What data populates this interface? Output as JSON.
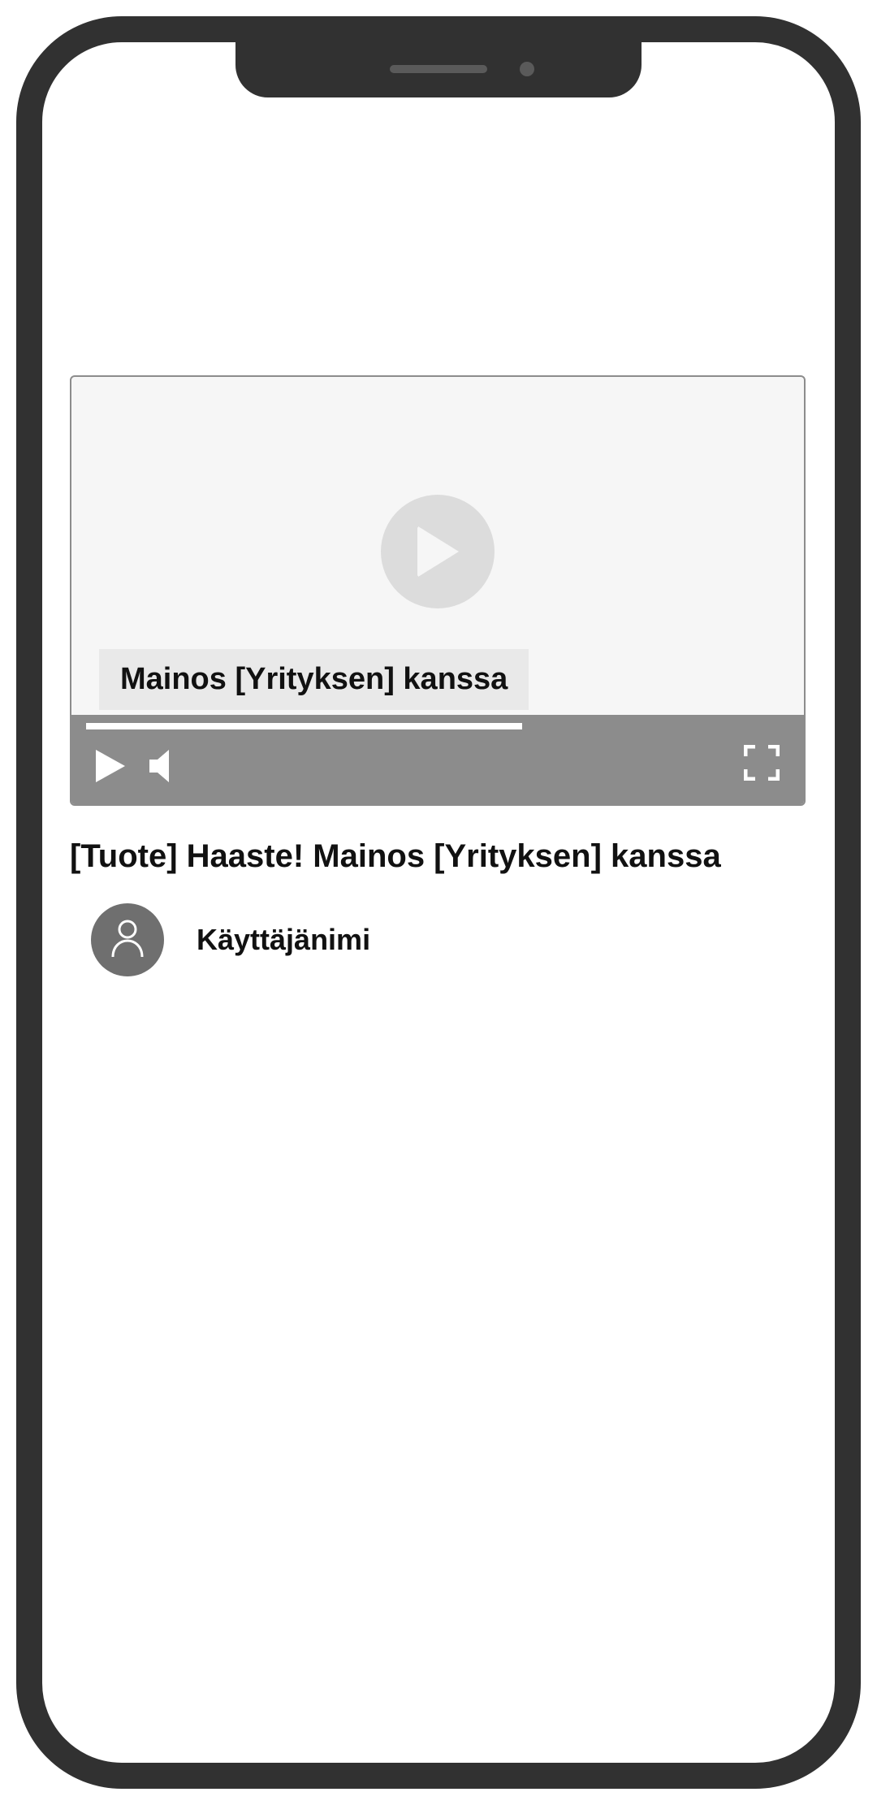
{
  "video": {
    "ad_label": "Mainos [Yrityksen] kanssa",
    "title": "[Tuote] Haaste! Mainos [Yrityksen] kanssa",
    "progress_percent": 62
  },
  "channel": {
    "username": "Käyttäjänimi"
  }
}
